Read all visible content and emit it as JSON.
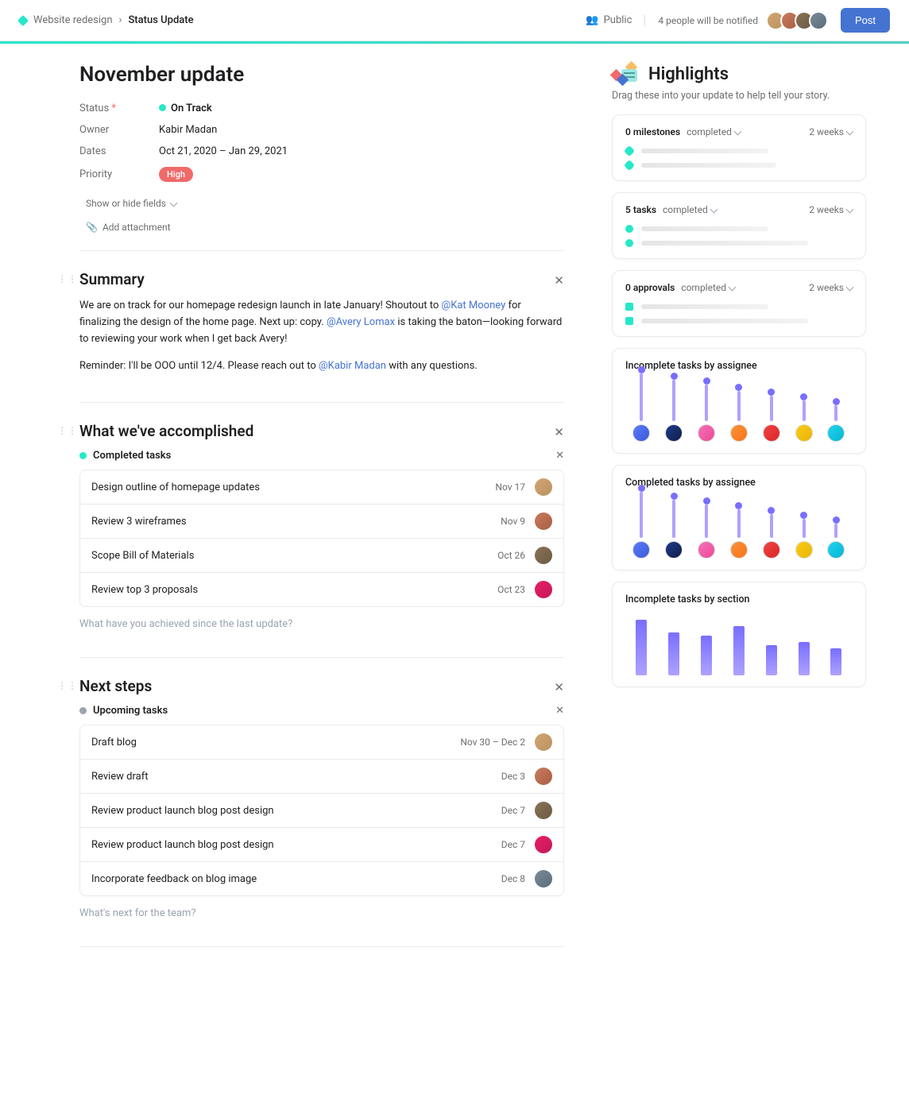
{
  "breadcrumb": {
    "project": "Website redesign",
    "current": "Status Update"
  },
  "topbar": {
    "visibility": "Public",
    "notify": "4 people will be notified",
    "post": "Post"
  },
  "title": "November update",
  "meta": {
    "status_label": "Status",
    "status_required": "*",
    "status_value": "On Track",
    "owner_label": "Owner",
    "owner_value": "Kabir Madan",
    "dates_label": "Dates",
    "dates_value": "Oct 21, 2020 – Jan 29, 2021",
    "priority_label": "Priority",
    "priority_value": "High",
    "show_hide": "Show or hide fields",
    "add_attachment": "Add attachment"
  },
  "summary": {
    "title": "Summary",
    "p1a": "We are on track for our homepage redesign launch in late January! Shoutout to ",
    "m1": "@Kat Mooney",
    "p1b": " for finalizing the design of the home page. Next up: copy. ",
    "m2": "@Avery Lomax",
    "p1c": " is taking the baton—looking forward to reviewing your work when I get back Avery!",
    "p2a": "Reminder: I'll be OOO until 12/4. Please reach out to ",
    "m3": "@Kabir Madan",
    "p2b": " with any questions."
  },
  "accomplished": {
    "title": "What we've accomplished",
    "subsection": "Completed tasks",
    "tasks": [
      {
        "name": "Design outline of homepage updates",
        "date": "Nov 17"
      },
      {
        "name": "Review 3 wireframes",
        "date": "Nov 9"
      },
      {
        "name": "Scope Bill of Materials",
        "date": "Oct 26"
      },
      {
        "name": "Review top 3 proposals",
        "date": "Oct 23"
      }
    ],
    "placeholder": "What have you achieved since the last update?"
  },
  "next": {
    "title": "Next steps",
    "subsection": "Upcoming tasks",
    "tasks": [
      {
        "name": "Draft blog",
        "date": "Nov 30 – Dec 2"
      },
      {
        "name": "Review draft",
        "date": "Dec 3"
      },
      {
        "name": "Review product launch blog post design",
        "date": "Dec 7"
      },
      {
        "name": "Review product launch blog post design",
        "date": "Dec 7"
      },
      {
        "name": "Incorporate feedback on blog image",
        "date": "Dec 8"
      }
    ],
    "placeholder": "What's next for the team?"
  },
  "highlights": {
    "title": "Highlights",
    "subtitle": "Drag these into your update to help tell your story.",
    "cards": [
      {
        "count": "0 milestones",
        "status": "completed",
        "range": "2 weeks"
      },
      {
        "count": "5 tasks",
        "status": "completed",
        "range": "2 weeks"
      },
      {
        "count": "0 approvals",
        "status": "completed",
        "range": "2 weeks"
      }
    ],
    "chart1": "Incomplete tasks by assignee",
    "chart2": "Completed tasks by assignee",
    "chart3": "Incomplete tasks by section"
  },
  "chart_data": [
    {
      "type": "bar",
      "title": "Incomplete tasks by assignee",
      "values": [
        60,
        52,
        46,
        38,
        32,
        26,
        20
      ]
    },
    {
      "type": "bar",
      "title": "Completed tasks by assignee",
      "values": [
        58,
        48,
        42,
        36,
        30,
        24,
        18
      ]
    },
    {
      "type": "bar",
      "title": "Incomplete tasks by section",
      "values": [
        70,
        54,
        50,
        62,
        38,
        42,
        34
      ]
    }
  ]
}
